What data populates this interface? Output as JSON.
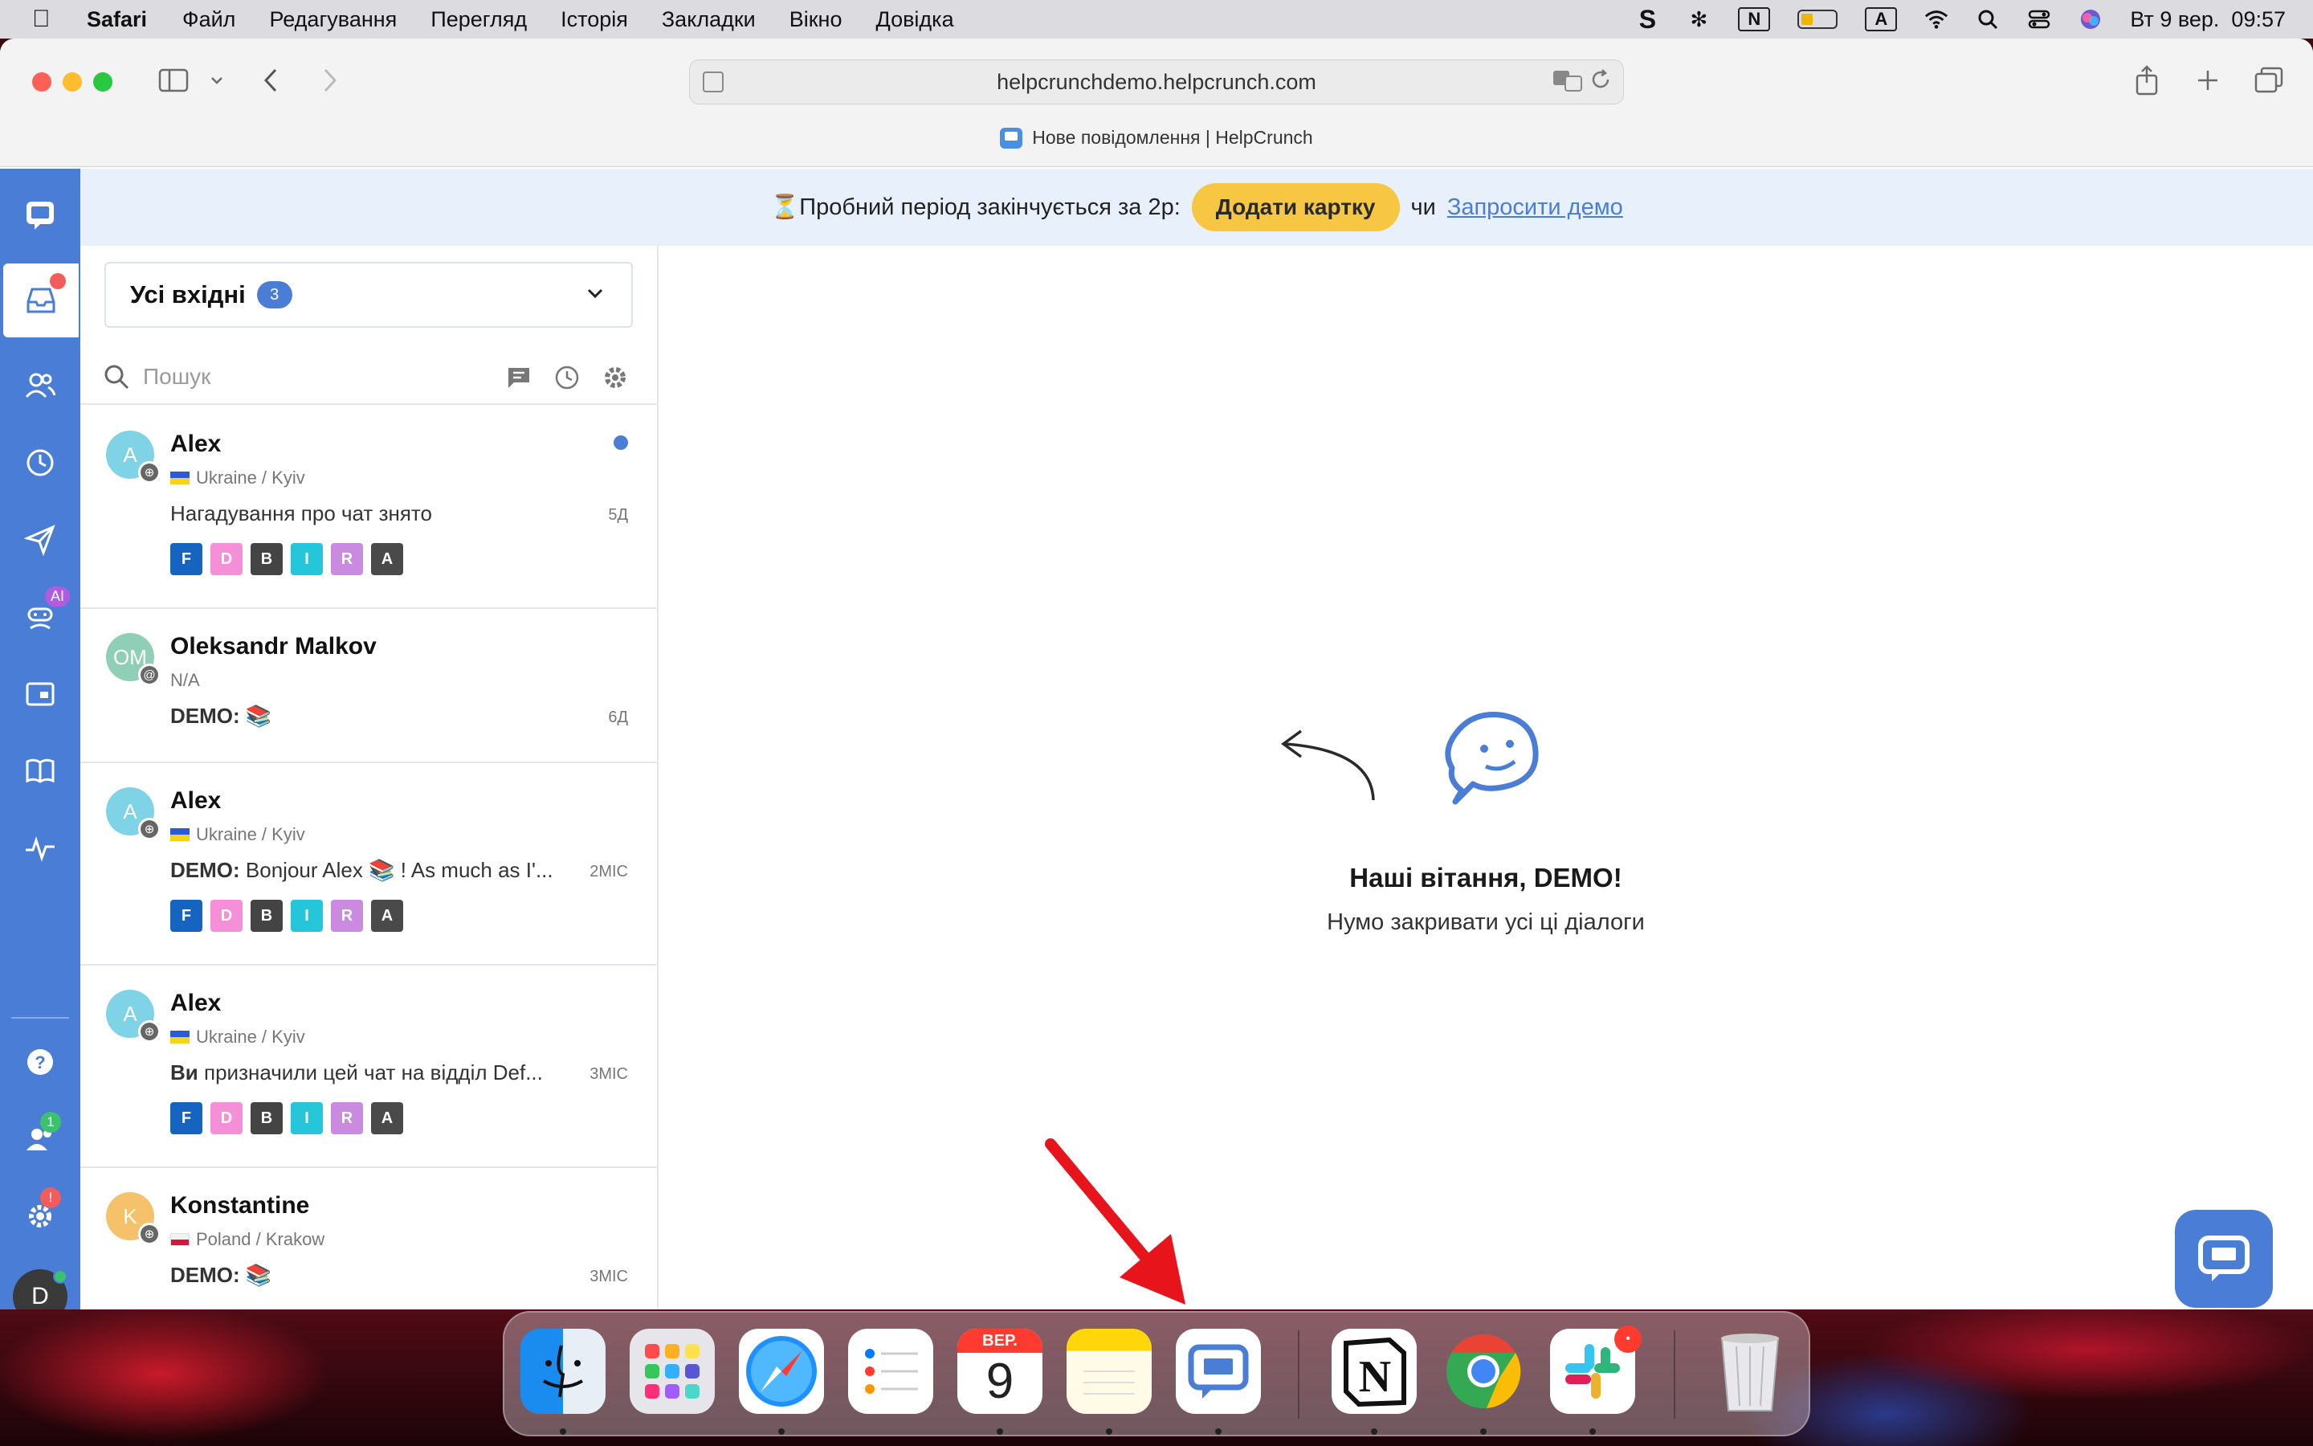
{
  "menubar": {
    "app_name": "Safari",
    "items": [
      "Файл",
      "Редагування",
      "Перегляд",
      "Історія",
      "Закладки",
      "Вікно",
      "Довідка"
    ],
    "input_indicator": "A",
    "notion_indicator": "N",
    "clock": "Вт 9 вер.  09:57"
  },
  "browser": {
    "url": "helpcrunchdemo.helpcrunch.com",
    "tab_title": "Нове повідомлення | HelpCrunch"
  },
  "banner": {
    "trial_text": "⏳Пробний період закінчується за 2р:",
    "add_card_label": "Додати картку",
    "or_text": "чи",
    "request_demo_label": "Запросити демо"
  },
  "rail": {
    "ai_badge": "AI",
    "team_badge": "1",
    "settings_badge": "!",
    "user_initial": "D"
  },
  "inbox": {
    "title": "Усі вхідні",
    "count": "3",
    "search_placeholder": "Пошук"
  },
  "conversations": [
    {
      "initials": "A",
      "avatar_color": "#7fd3e6",
      "name": "Alex",
      "location": "Ukraine / Kyiv",
      "flag": "ua",
      "msg_prefix": "",
      "message": "Нагадування про чат знято",
      "time": "5Д",
      "unread": true,
      "tags": [
        "F",
        "D",
        "B",
        "I",
        "R",
        "A"
      ]
    },
    {
      "initials": "OM",
      "avatar_color": "#8fcfb5",
      "name": "Oleksandr Malkov",
      "location": "N/A",
      "flag": "",
      "msg_prefix": "DEMO:",
      "message": "📚",
      "time": "6Д",
      "unread": false,
      "tags": []
    },
    {
      "initials": "A",
      "avatar_color": "#7fd3e6",
      "name": "Alex",
      "location": "Ukraine / Kyiv",
      "flag": "ua",
      "msg_prefix": "DEMO:",
      "message": "Bonjour Alex 📚 ! As much as I'...",
      "time": "2МІС",
      "unread": false,
      "tags": [
        "F",
        "D",
        "B",
        "I",
        "R",
        "A"
      ]
    },
    {
      "initials": "A",
      "avatar_color": "#7fd3e6",
      "name": "Alex",
      "location": "Ukraine / Kyiv",
      "flag": "ua",
      "msg_prefix": "Ви",
      "message": "призначили цей чат на відділ Def...",
      "time": "3МІС",
      "unread": false,
      "tags": [
        "F",
        "D",
        "B",
        "I",
        "R",
        "A"
      ]
    },
    {
      "initials": "K",
      "avatar_color": "#f5c26b",
      "name": "Konstantine",
      "location": "Poland / Krakow",
      "flag": "pl",
      "msg_prefix": "DEMO:",
      "message": "📚",
      "time": "3МІС",
      "unread": false,
      "tags": []
    }
  ],
  "tag_colors": {
    "F": "#1565c0",
    "D": "#f48fd8",
    "B": "#444444",
    "I": "#26c6da",
    "R": "#c98ae0",
    "A": "#4a4a4a"
  },
  "empty_state": {
    "title": "Наші вітання, DEMO!",
    "subtitle": "Нумо закривати усі ці діалоги"
  },
  "dock": {
    "calendar_month": "ВЕР.",
    "calendar_day": "9"
  },
  "colors": {
    "brand": "#4a7ed6",
    "accent_button": "#f7c744"
  }
}
